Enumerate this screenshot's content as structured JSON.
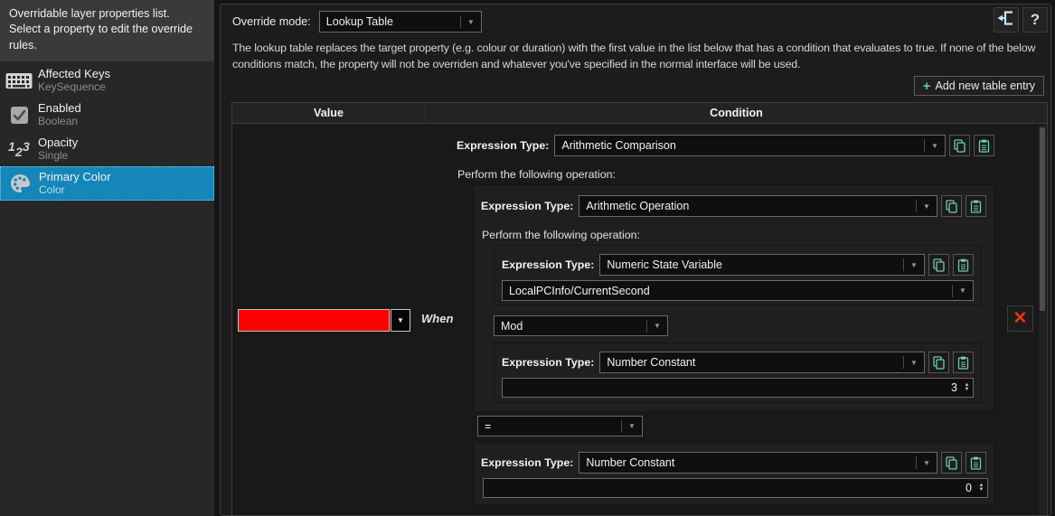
{
  "labels": {
    "expression_type": "Expression Type:",
    "perform_operation": "Perform the following operation:"
  },
  "sidebar": {
    "header": "Overridable layer properties list. Select a property to edit the override rules.",
    "items": [
      {
        "label": "Affected Keys",
        "type": "KeySequence",
        "icon": "keyboard-icon",
        "selected": false
      },
      {
        "label": "Enabled",
        "type": "Boolean",
        "icon": "checkbox-icon",
        "selected": false
      },
      {
        "label": "Opacity",
        "type": "Single",
        "icon": "numbers-icon",
        "selected": false
      },
      {
        "label": "Primary Color",
        "type": "Color",
        "icon": "palette-icon",
        "selected": true
      }
    ]
  },
  "header": {
    "override_mode_label": "Override mode:",
    "override_mode_value": "Lookup Table",
    "help_glyph": "?",
    "description": "The lookup table replaces the target property (e.g. colour or duration) with the first value in the list below that has a condition that evaluates to true. If none of the below conditions match, the property will not be overriden and whatever you've specified in the normal interface will be used.",
    "add_entry_label": "Add new table entry",
    "add_entry_plus": "+"
  },
  "table": {
    "columns": [
      "Value",
      "Condition"
    ],
    "row": {
      "value": {
        "color": "#FF0000",
        "when_label": "When"
      },
      "condition": {
        "type": "Arithmetic Comparison",
        "operand1": {
          "type": "Arithmetic Operation",
          "operand1": {
            "type": "Numeric State Variable",
            "variable": "LocalPCInfo/CurrentSecond"
          },
          "operator": "Mod",
          "operand2": {
            "type": "Number Constant",
            "value": "3"
          }
        },
        "operator": "=",
        "operand2": {
          "type": "Number Constant",
          "value": "0"
        }
      }
    }
  },
  "colors": {
    "selection_blue": "#1486B8",
    "accent_teal": "#6FCAB6",
    "value_swatch": "#FF0000",
    "delete_red": "#E8380D",
    "icon_blue": "#C9E2F2"
  }
}
